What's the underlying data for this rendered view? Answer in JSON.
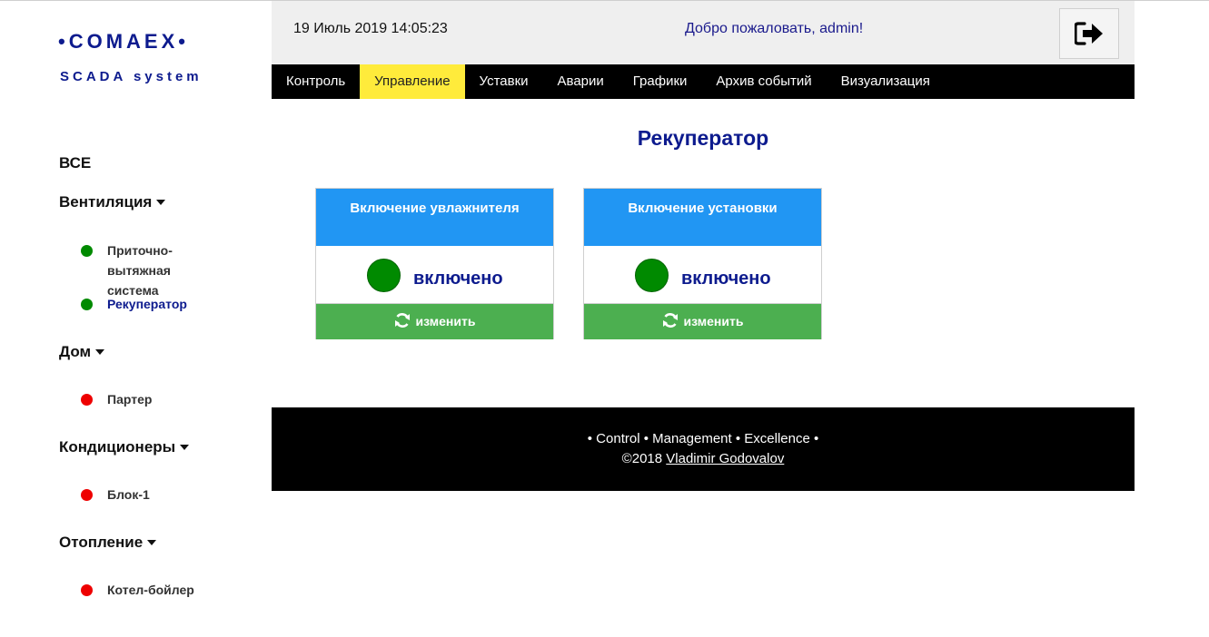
{
  "brand": {
    "logo": "•COMAEX•",
    "subtitle": "SCADA system"
  },
  "sidebar": {
    "all_label": "ВСЕ",
    "groups": [
      {
        "label": "Вентиляция",
        "items": [
          {
            "label": "Приточно-вытяжная система",
            "status": "green"
          },
          {
            "label": "Рекуператор",
            "status": "green",
            "active": true
          }
        ]
      },
      {
        "label": "Дом",
        "items": [
          {
            "label": "Партер",
            "status": "red"
          }
        ]
      },
      {
        "label": "Кондиционеры",
        "items": [
          {
            "label": "Блок-1",
            "status": "red"
          }
        ]
      },
      {
        "label": "Отопление",
        "items": [
          {
            "label": "Котел-бойлер",
            "status": "red"
          }
        ]
      }
    ]
  },
  "header": {
    "datetime": "19 Июль 2019 14:05:23",
    "welcome": "Добро пожаловать, admin!",
    "logout_icon": "sign-out-icon"
  },
  "nav": {
    "tabs": [
      {
        "label": "Контроль"
      },
      {
        "label": "Управление",
        "active": true
      },
      {
        "label": "Уставки"
      },
      {
        "label": "Аварии"
      },
      {
        "label": "Графики"
      },
      {
        "label": "Архив событий"
      },
      {
        "label": "Визуализация"
      }
    ]
  },
  "main": {
    "title": "Рекуператор",
    "cards": [
      {
        "title": "Включение увлажнителя",
        "state": "включено",
        "button": "изменить"
      },
      {
        "title": "Включение установки",
        "state": "включено",
        "button": "изменить"
      }
    ]
  },
  "footer": {
    "tagline": "• Control • Management • Excellence •",
    "copyright": "©2018",
    "author": "Vladimir Godovalov"
  },
  "colors": {
    "brand": "#0d1b8e",
    "active_tab": "#ffeb3b",
    "card_header": "#2196f3",
    "button": "#4caf50",
    "status_on": "#008a00",
    "status_off": "#ee0000"
  }
}
